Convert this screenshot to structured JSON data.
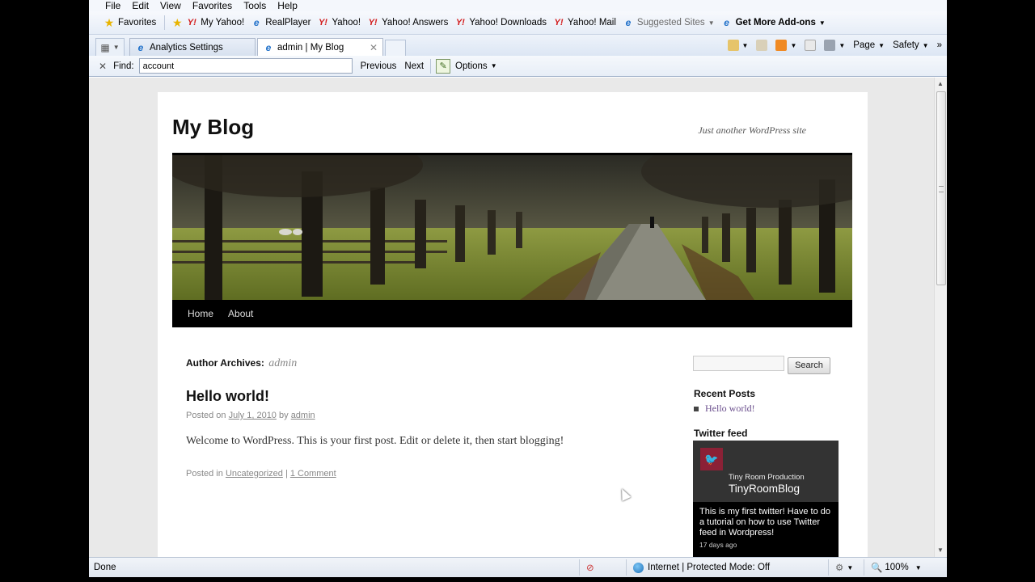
{
  "menu": [
    "File",
    "Edit",
    "View",
    "Favorites",
    "Tools",
    "Help"
  ],
  "favorites": {
    "label": "Favorites",
    "items": [
      {
        "label": "My Yahoo!",
        "icon": "yahoo-icon"
      },
      {
        "label": "RealPlayer",
        "icon": "ie-page-icon"
      },
      {
        "label": "Yahoo!",
        "icon": "yahoo-icon"
      },
      {
        "label": "Yahoo! Answers",
        "icon": "yahoo-icon"
      },
      {
        "label": "Yahoo! Downloads",
        "icon": "yahoo-icon"
      },
      {
        "label": "Yahoo! Mail",
        "icon": "yahoo-icon"
      },
      {
        "label": "Suggested Sites",
        "icon": "ie-page-icon"
      },
      {
        "label": "Get More Add-ons",
        "icon": "ie-page-icon"
      }
    ]
  },
  "tabs": [
    {
      "title": "Analytics Settings",
      "active": false
    },
    {
      "title": "admin | My Blog",
      "active": true
    }
  ],
  "commands": {
    "page": "Page",
    "safety": "Safety"
  },
  "find": {
    "label": "Find:",
    "value": "account",
    "previous": "Previous",
    "next": "Next",
    "options": "Options"
  },
  "blog": {
    "title": "My Blog",
    "tagline": "Just another WordPress site",
    "nav": [
      "Home",
      "About"
    ],
    "archive_label": "Author Archives:",
    "archive_author": "admin",
    "post": {
      "title": "Hello world!",
      "posted_on": "Posted on",
      "date": "July 1, 2010",
      "by": "by",
      "author": "admin",
      "content": "Welcome to WordPress. This is your first post. Edit or delete it, then start blogging!",
      "posted_in": "Posted in",
      "category": "Uncategorized",
      "separator": "|",
      "comments": "1 Comment"
    },
    "sidebar": {
      "search_button": "Search",
      "recent_title": "Recent Posts",
      "recent_items": [
        "Hello world!"
      ],
      "twitter_title": "Twitter feed",
      "twitter": {
        "account_label": "Tiny Room Production",
        "account_name": "TinyRoomBlog",
        "tweet": "This is my first twitter! Have to do a tutorial on how to use Twitter feed in Wordpress!",
        "time": "17 days ago"
      }
    }
  },
  "status": {
    "text": "Done",
    "zone": "Internet | Protected Mode: Off",
    "zoom": "100%"
  },
  "colors": {
    "accent": "#1e6fc9",
    "yahoo": "#d21a1a",
    "twitter_logo": "#8b2136",
    "recent_link": "#6b4f8d"
  }
}
